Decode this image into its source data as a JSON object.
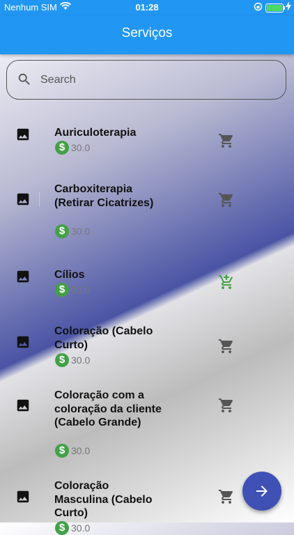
{
  "status_bar": {
    "carrier": "Nenhum SIM",
    "time": "01:28"
  },
  "app_bar": {
    "title": "Serviços"
  },
  "search": {
    "placeholder": "Search"
  },
  "services": [
    {
      "name": "Auriculoterapia",
      "price": "30.0",
      "in_cart": false
    },
    {
      "name": "Carboxiterapia (Retirar Cicatrizes)",
      "price": "30.0",
      "in_cart": false
    },
    {
      "name": "Cílios",
      "price": "30.0",
      "in_cart": true
    },
    {
      "name": "Coloração (Cabelo Curto)",
      "price": "30.0",
      "in_cart": false
    },
    {
      "name": "Coloração com a coloração da cliente (Cabelo Grande)",
      "price": "30.0",
      "in_cart": false
    },
    {
      "name": "Coloração Masculina (Cabelo Curto)",
      "price": "30.0",
      "in_cart": false
    }
  ],
  "currency_symbol": "$",
  "colors": {
    "primary": "#2196F3",
    "fab": "#3f51b5",
    "price_icon": "#43a047",
    "cart_added": "#43a047",
    "cart_default": "#555555"
  }
}
